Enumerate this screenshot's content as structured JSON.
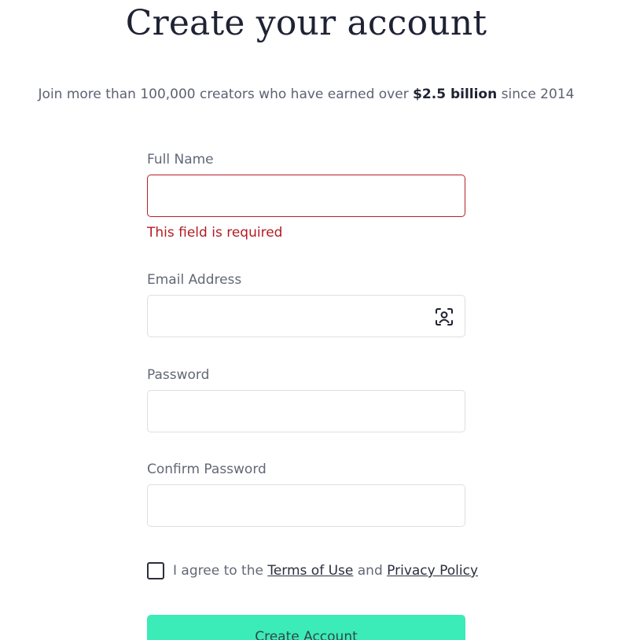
{
  "page": {
    "title": "Create your account",
    "subtitle_prefix": "Join more than 100,000 creators who have earned over ",
    "subtitle_highlight": "$2.5 billion",
    "subtitle_suffix": " since 2014"
  },
  "form": {
    "full_name": {
      "label": "Full Name",
      "value": "",
      "error": "This field is required"
    },
    "email": {
      "label": "Email Address",
      "value": "",
      "icon": "contact-autofill-icon"
    },
    "password": {
      "label": "Password",
      "value": ""
    },
    "confirm_password": {
      "label": "Confirm Password",
      "value": ""
    },
    "agree": {
      "checked": false,
      "prefix": "I agree to the ",
      "terms_link": "Terms of Use",
      "middle": " and ",
      "privacy_link": "Privacy Policy"
    },
    "submit_label": "Create Account"
  },
  "colors": {
    "accent_button": "#3bebb8",
    "error": "#b21b22",
    "heading": "#1e2233"
  }
}
